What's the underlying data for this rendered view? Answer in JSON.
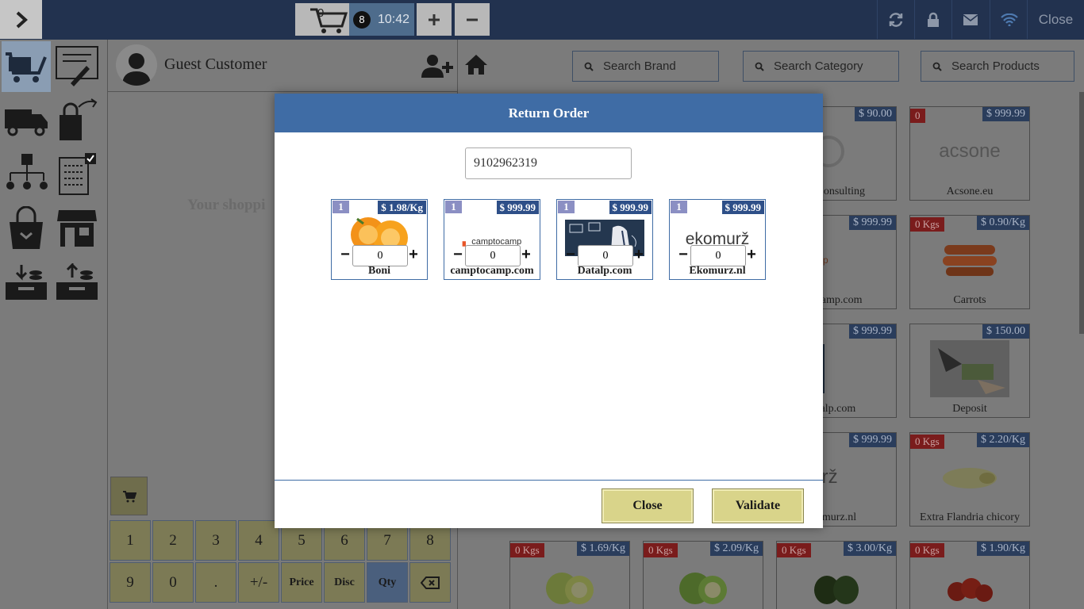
{
  "topbar": {
    "cart_count": "0",
    "order_badge": "8",
    "order_time": "10:42",
    "close_label": "Close"
  },
  "customer": {
    "name": "Guest Customer"
  },
  "cart": {
    "empty_text": "Your shoppi"
  },
  "numpad": {
    "keys_row1": [
      "1",
      "2",
      "3",
      "4",
      "5",
      "6",
      "7",
      "8"
    ],
    "keys_row2": [
      "9",
      "0",
      ".",
      "+/-",
      "Price",
      "Disc",
      "Qty",
      "⌫"
    ]
  },
  "search": {
    "brand_placeholder": "Search Brand",
    "category_placeholder": "Search Category",
    "products_placeholder": "Search Products"
  },
  "background_products": [
    {
      "name": "d Consulting",
      "price": "$ 90.00",
      "stock": ""
    },
    {
      "name": "Acsone.eu",
      "price": "$ 999.99",
      "stock": "0"
    },
    {
      "name": "ocamp.com",
      "price": "$ 999.99",
      "stock": ""
    },
    {
      "name": "Carrots",
      "price": "$ 0.90/Kg",
      "stock": "0 Kgs"
    },
    {
      "name": "talp.com",
      "price": "$ 999.99",
      "stock": ""
    },
    {
      "name": "Deposit",
      "price": "$ 150.00",
      "stock": ""
    },
    {
      "name": "omurz.nl",
      "price": "$ 999.99",
      "stock": ""
    },
    {
      "name": "Extra Flandria chicory",
      "price": "$ 2.20/Kg",
      "stock": "0 Kgs"
    },
    {
      "name": "",
      "price": "$ 1.69/Kg",
      "stock": "0 Kgs"
    },
    {
      "name": "",
      "price": "$ 2.09/Kg",
      "stock": "0 Kgs"
    },
    {
      "name": "",
      "price": "$ 3.00/Kg",
      "stock": "0 Kgs"
    },
    {
      "name": "",
      "price": "$ 1.90/Kg",
      "stock": "0 Kgs"
    }
  ],
  "modal": {
    "title": "Return Order",
    "order_number": "9102962319",
    "items": [
      {
        "name": "Boni",
        "price": "$ 1.98/Kg",
        "qty_badge": "1",
        "return_qty": "0",
        "image": "oranges-image"
      },
      {
        "name": "camptocamp.com",
        "price": "$ 999.99",
        "qty_badge": "1",
        "return_qty": "0",
        "image": "camptocamp-logo"
      },
      {
        "name": "Datalp.com",
        "price": "$ 999.99",
        "qty_badge": "1",
        "return_qty": "0",
        "image": "datalp-image"
      },
      {
        "name": "Ekomurz.nl",
        "price": "$ 999.99",
        "qty_badge": "1",
        "return_qty": "0",
        "image": "ekomurz-logo"
      }
    ],
    "logo_texts": {
      "camptocamp": "camptocamp",
      "acsone": "acsone",
      "ekomurz": "ekomurž"
    },
    "close_label": "Close",
    "validate_label": "Validate"
  }
}
